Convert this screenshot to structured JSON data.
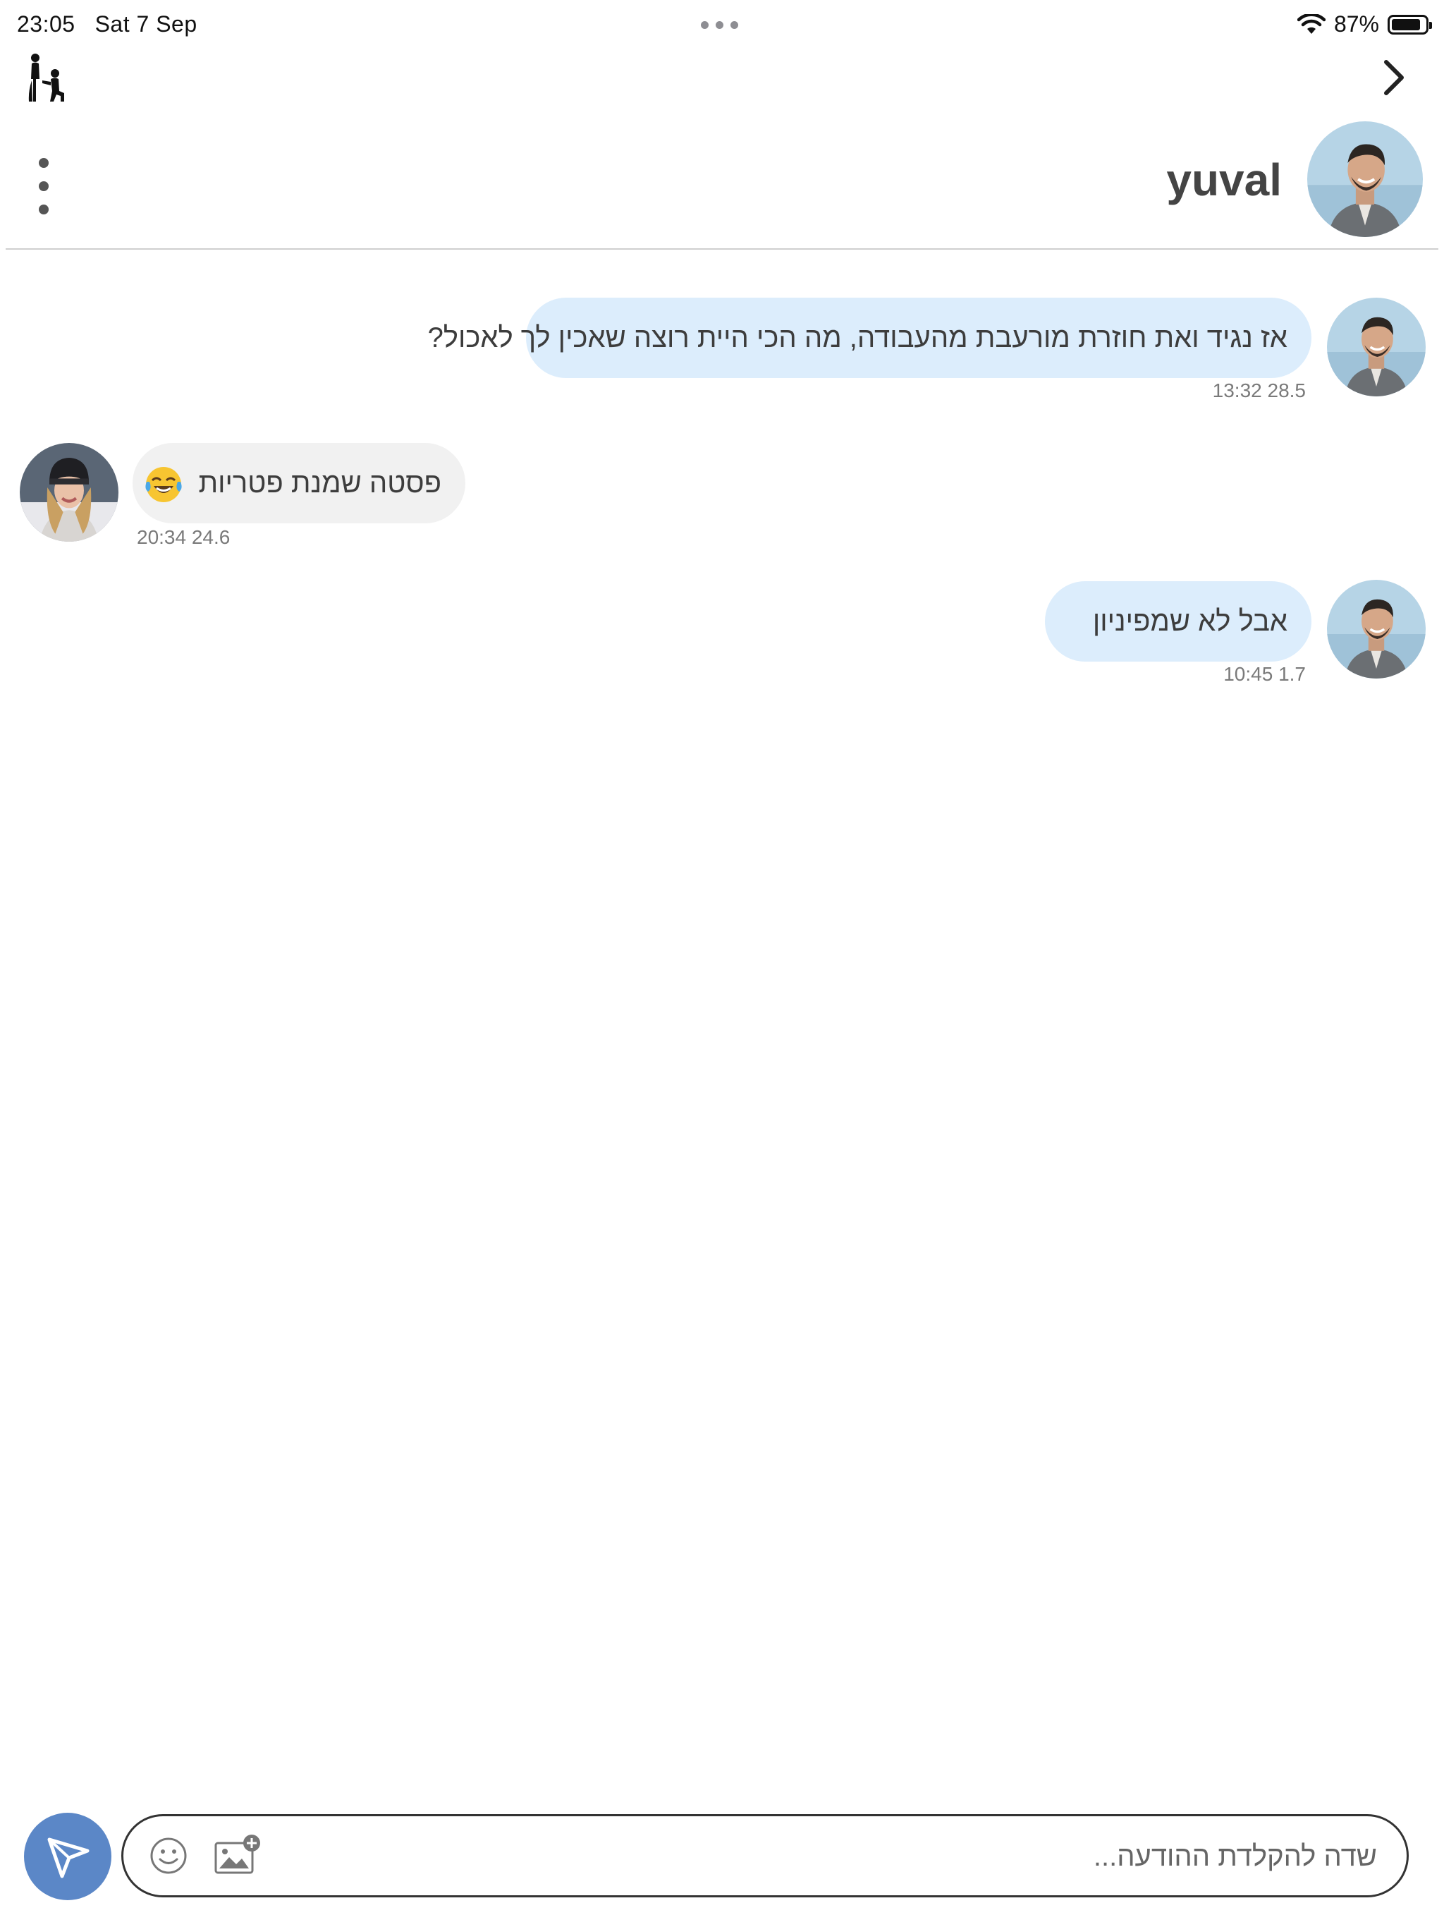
{
  "status_bar": {
    "time": "23:05",
    "date": "Sat 7 Sep",
    "battery": "87%",
    "battery_level": 0.87
  },
  "nav": {
    "logo_icon": "couple-proposal-icon",
    "back_icon": "chevron-right-icon"
  },
  "header": {
    "contact_name": "yuval",
    "menu_icon": "more-vertical-icon"
  },
  "messages": [
    {
      "direction": "outgoing",
      "text": "אז נגיד ואת חוזרת מורעבת מהעבודה, מה הכי היית רוצה שאכין לך לאכול?",
      "time": "13:32 28.5"
    },
    {
      "direction": "incoming",
      "text": "פסטה שמנת פטריות",
      "emoji": "face-with-tears-of-joy",
      "time": "20:34 24.6"
    },
    {
      "direction": "outgoing",
      "text": "אבל לא שמפיניון",
      "time": "10:45 1.7"
    }
  ],
  "composer": {
    "placeholder": "שדה להקלדת ההודעה...",
    "value": "",
    "emoji_icon": "smiley-icon",
    "image_icon": "add-image-icon",
    "send_icon": "send-icon"
  },
  "colors": {
    "outgoing_bubble": "#dcedfc",
    "incoming_bubble": "#f1f1f1",
    "send_button": "#5b87c7"
  }
}
